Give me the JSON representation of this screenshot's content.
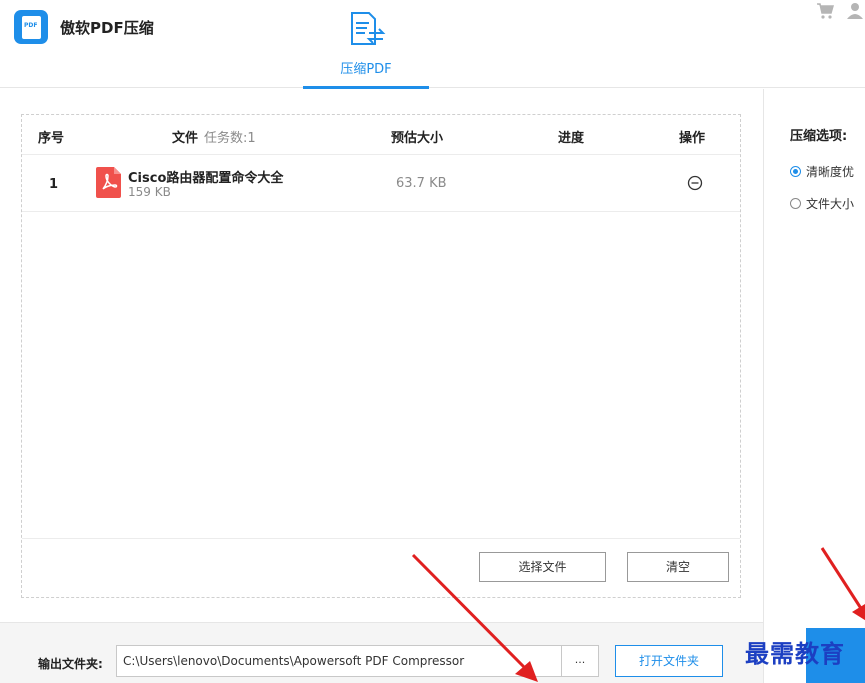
{
  "header": {
    "app_title": "傲软PDF压缩",
    "logo_text": "PDF",
    "tab": {
      "label": "压缩PDF",
      "icon": "compress-document-icon",
      "active": true
    },
    "icons": [
      "cart-icon",
      "user-icon"
    ]
  },
  "file_table": {
    "headers": {
      "index": "序号",
      "file": "文件",
      "task_count": "任务数:1",
      "estimated_size": "预估大小",
      "progress": "进度",
      "action": "操作"
    },
    "rows": [
      {
        "index": "1",
        "name": "Cisco路由器配置命令大全",
        "size": "159 KB",
        "estimated_size": "63.7 KB",
        "progress": "",
        "icon": "pdf-icon",
        "action_icon": "remove-icon"
      }
    ],
    "buttons": {
      "select_file": "选择文件",
      "clear": "清空"
    }
  },
  "options": {
    "title": "压缩选项:",
    "radios": [
      {
        "label": "清晰度优",
        "checked": true
      },
      {
        "label": "文件大小",
        "checked": false
      }
    ]
  },
  "output": {
    "label": "输出文件夹:",
    "path": "C:\\Users\\lenovo\\Documents\\Apowersoft PDF Compressor",
    "browse": "...",
    "open_folder": "打开文件夹"
  },
  "watermark": {
    "text": "最需教育"
  },
  "colors": {
    "accent": "#1e8ee9",
    "pdf_red": "#f0514c",
    "arrow_red": "#e02020",
    "watermark_blue": "#1c3fc2"
  }
}
